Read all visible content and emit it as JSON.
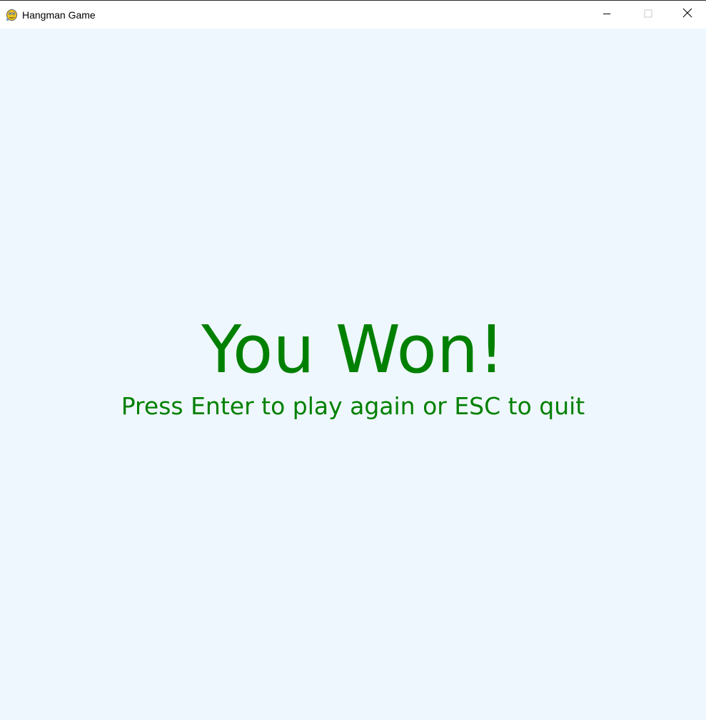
{
  "window": {
    "title": "Hangman Game",
    "app_icon": "pygame-snake-icon",
    "controls": {
      "minimize_icon": "minimize-icon",
      "maximize_icon": "maximize-icon",
      "close_icon": "close-icon"
    }
  },
  "game": {
    "result_text": "You Won!",
    "instruction_text": "Press Enter to play again or ESC to quit"
  },
  "colors": {
    "background": "#eef7fe",
    "text": "#008000",
    "titlebar": "#ffffff"
  }
}
